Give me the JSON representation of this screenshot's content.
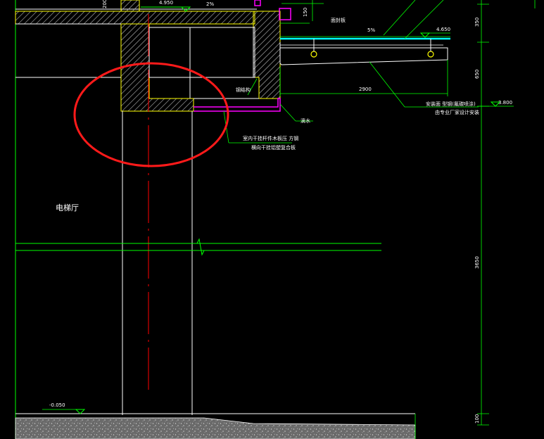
{
  "drawing": {
    "room_label": "电梯厅",
    "annotations": {
      "drip_line": "滴水",
      "steel_panel": "钢结构",
      "top_panel": "面封板",
      "glass_roof": "安装面 型钢(氟碳喷涂)",
      "glass_roof_2": "由专业厂家设计安装",
      "note_line_1": "室内干挂杆件木板压 方钢",
      "note_line_2": "横向干挂铝塑复合板"
    },
    "elevations": {
      "top_mid": "4.950",
      "canopy": "4.650",
      "right_level": "3.800",
      "floor": "-0.050"
    },
    "dimensions": {
      "canopy_width": "2900",
      "slope": "2%",
      "slope_right": "5%",
      "right_top": "350",
      "right_mid": "650",
      "right_main": "3650",
      "right_bottom": "100",
      "small_150": "150",
      "small_200": "200"
    },
    "colors": {
      "background": "#000000",
      "wall_line": "#ffff00",
      "hatch": "#ffffff",
      "dimension": "#00ff00",
      "cyan_beam": "#00ffff",
      "magenta": "#ff00ff",
      "centerline": "#ff0000",
      "highlight_circle": "#ff1a1a"
    }
  }
}
